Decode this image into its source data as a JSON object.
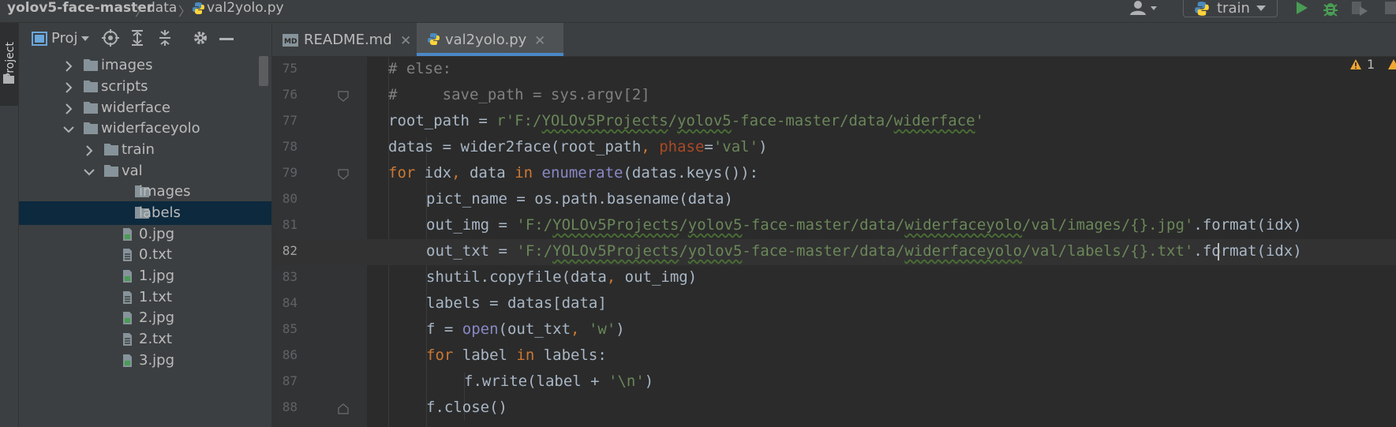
{
  "breadcrumbs": [
    "yolov5-face-master",
    "data",
    "val2yolo.py"
  ],
  "run_config": "train",
  "project_panel": {
    "stripe_label": "Project",
    "title": "Proj",
    "tree": [
      {
        "label": "images",
        "type": "folder",
        "expanded": false
      },
      {
        "label": "scripts",
        "type": "folder",
        "expanded": false
      },
      {
        "label": "widerface",
        "type": "folder",
        "expanded": false
      },
      {
        "label": "widerfaceyolo",
        "type": "folder",
        "expanded": true
      },
      {
        "label": "train",
        "type": "folder",
        "expanded": false
      },
      {
        "label": "val",
        "type": "folder",
        "expanded": true
      },
      {
        "label": "images",
        "type": "folder"
      },
      {
        "label": "labels",
        "type": "folder",
        "selected": true
      },
      {
        "label": "0.jpg",
        "type": "image"
      },
      {
        "label": "0.txt",
        "type": "text"
      },
      {
        "label": "1.jpg",
        "type": "image"
      },
      {
        "label": "1.txt",
        "type": "text"
      },
      {
        "label": "2.jpg",
        "type": "image"
      },
      {
        "label": "2.txt",
        "type": "text"
      },
      {
        "label": "3.jpg",
        "type": "image"
      }
    ]
  },
  "tabs": [
    {
      "label": "README.md",
      "active": false
    },
    {
      "label": "val2yolo.py",
      "active": true
    }
  ],
  "editor": {
    "warnings_count": "1",
    "current_line": "82",
    "lines": [
      {
        "n": "75",
        "text": "# else:"
      },
      {
        "n": "76",
        "text": "#     save_path = sys.argv[2]"
      },
      {
        "n": "77",
        "text": "root_path = r'F:/YOLOv5Projects/yolov5-face-master/data/widerface'"
      },
      {
        "n": "78",
        "text": "datas = wider2face(root_path, phase='val')"
      },
      {
        "n": "79",
        "text": "for idx, data in enumerate(datas.keys()):"
      },
      {
        "n": "80",
        "text": "pict_name = os.path.basename(data)"
      },
      {
        "n": "81",
        "text": "out_img = 'F:/YOLOv5Projects/yolov5-face-master/data/widerfaceyolo/val/images/{}.jpg'.format(idx)"
      },
      {
        "n": "82",
        "text": "out_txt = 'F:/YOLOv5Projects/yolov5-face-master/data/widerfaceyolo/val/labels/{}.txt'.format(idx)"
      },
      {
        "n": "83",
        "text": "shutil.copyfile(data, out_img)"
      },
      {
        "n": "84",
        "text": "labels = datas[data]"
      },
      {
        "n": "85",
        "text": "f = open(out_txt, 'w')"
      },
      {
        "n": "86",
        "text": "for label in labels:"
      },
      {
        "n": "87",
        "text": "f.write(label + '\\n')"
      },
      {
        "n": "88",
        "text": "f.close()"
      }
    ]
  },
  "colors": {
    "keyword": "#cc7832",
    "string": "#6a8759",
    "comment": "#808080",
    "builtin": "#8888c6",
    "selection": "#0d293e",
    "accent": "#4a88c7"
  }
}
